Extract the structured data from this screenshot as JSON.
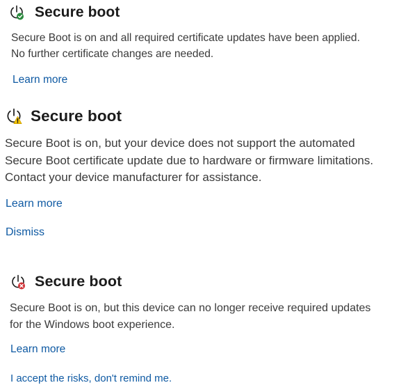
{
  "colors": {
    "title": "#1b1b1b",
    "text": "#3a3a3a",
    "link": "#0f5aa3",
    "success": "#2b8a3e",
    "warning": "#f2c200",
    "error": "#d13438"
  },
  "cards": [
    {
      "icon": "power-icon-success",
      "title": "Secure boot",
      "description_lines": [
        "Secure Boot is on and all required certificate updates have been applied.",
        "No further certificate changes are needed."
      ],
      "links": [
        "Learn more"
      ]
    },
    {
      "icon": "power-icon-warning",
      "title": "Secure boot",
      "description_lines": [
        "Secure Boot is on, but your device does not support the automated",
        "Secure Boot certificate update due to hardware or firmware limitations.",
        "Contact your device manufacturer for assistance."
      ],
      "links": [
        "Learn more",
        "Dismiss"
      ]
    },
    {
      "icon": "power-icon-error",
      "title": "Secure boot",
      "description_lines": [
        "Secure Boot is on, but this device can no longer receive required updates",
        "for the Windows boot experience."
      ],
      "links": [
        "Learn more",
        "I accept the risks, don't remind me."
      ]
    }
  ]
}
